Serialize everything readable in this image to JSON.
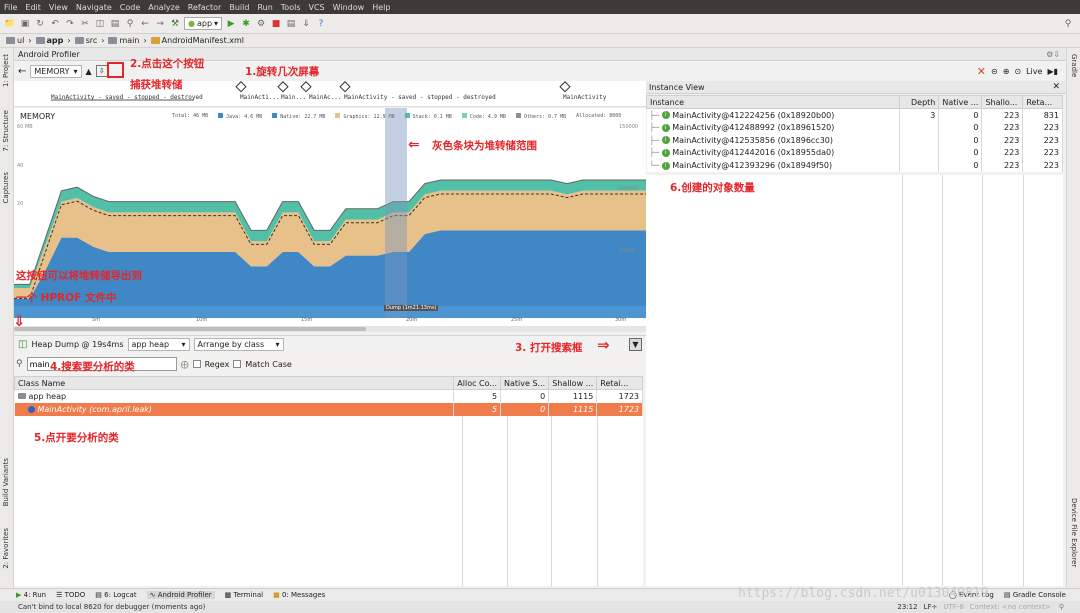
{
  "menu": [
    "File",
    "Edit",
    "View",
    "Navigate",
    "Code",
    "Analyze",
    "Refactor",
    "Build",
    "Run",
    "Tools",
    "VCS",
    "Window",
    "Help"
  ],
  "toolbar": {
    "run_config": "app",
    "help_label": "?"
  },
  "breadcrumb": [
    "ul",
    "app",
    "src",
    "main",
    "AndroidManifest.xml"
  ],
  "profiler": {
    "title": "Android Profiler",
    "monitor": "MEMORY",
    "live_label": "Live",
    "chart_title": "MEMORY",
    "legend": [
      "Total: 46 MB",
      "Java: 4.6 MB",
      "Native: 22.7 MB",
      "Graphics: 12.9 MB",
      "Stack: 0.1 MB",
      "Code: 4.9 MB",
      "Others: 0.7 MB",
      "Allocated: 8000"
    ],
    "y_labels": [
      "60 MB",
      "40",
      "20",
      "150000",
      "100000",
      "50000"
    ],
    "x_labels": [
      "5m",
      "10m",
      "15m",
      "20m",
      "25m",
      "30m"
    ],
    "activity_labels": [
      "MainActivity - saved - stopped - destroyed",
      "MainActi...",
      "Main...",
      "MainAc...",
      "MainActivity - saved - stopped - destroyed",
      "MainActivity"
    ],
    "dump_tooltip": "Dump (1m21.13ms)"
  },
  "heap": {
    "dump_label": "Heap Dump @ 19s4ms",
    "heap_select": "app heap",
    "arrange_select": "Arrange by class",
    "search_value": "main",
    "regex_label": "Regex",
    "match_case_label": "Match Case",
    "columns": [
      "Class Name",
      "Alloc Co...",
      "Native S...",
      "Shallow ...",
      "Retai..."
    ],
    "rows": [
      {
        "name": "app heap",
        "alloc": "5",
        "native": "0",
        "shallow": "1115",
        "retained": "1723"
      },
      {
        "name": "MainActivity (com.april.leak)",
        "alloc": "5",
        "native": "0",
        "shallow": "1115",
        "retained": "1723"
      }
    ]
  },
  "instance_view": {
    "title": "Instance View",
    "columns": [
      "Instance",
      "Depth",
      "Native ...",
      "Shallo...",
      "Reta..."
    ],
    "rows": [
      {
        "name": "MainActivity@412224256 (0x18920b00)",
        "depth": "3",
        "native": "0",
        "shallow": "223",
        "retained": "831"
      },
      {
        "name": "MainActivity@412488992 (0x18961520)",
        "depth": "",
        "native": "0",
        "shallow": "223",
        "retained": "223"
      },
      {
        "name": "MainActivity@412535856 (0x1896cc30)",
        "depth": "",
        "native": "0",
        "shallow": "223",
        "retained": "223"
      },
      {
        "name": "MainActivity@412442016 (0x18955da0)",
        "depth": "",
        "native": "0",
        "shallow": "223",
        "retained": "223"
      },
      {
        "name": "MainActivity@412393296 (0x18949f50)",
        "depth": "",
        "native": "0",
        "shallow": "223",
        "retained": "223"
      }
    ]
  },
  "side_tabs": {
    "left": [
      "1: Project",
      "7: Structure",
      "Captures",
      "Build Variants",
      "2: Favorites"
    ],
    "right": [
      "Gradle",
      "Device File Explorer"
    ]
  },
  "bottom_tabs": [
    "4: Run",
    "TODO",
    "6: Logcat",
    "Android Profiler",
    "Terminal",
    "0: Messages"
  ],
  "bottom_right": [
    "Event Log",
    "Gradle Console"
  ],
  "status": {
    "message": "Can't bind to local 8620 for debugger (moments ago)",
    "position": "23:12",
    "lf": "LF÷",
    "encoding": "UTF-8",
    "context": "Context: <no context>"
  },
  "annotations": {
    "a1": "1.旋转几次屏幕",
    "a2": "2.点击这个按钮",
    "a2b": "捕获堆转储",
    "a3": "3. 打开搜索框",
    "a4": "4.搜索要分析的类",
    "a5": "5.点开要分析的类",
    "a6": "6.创建的对象数量",
    "a7": "灰色条块为堆转储范围",
    "a8": "这按钮可以将堆转储导出到",
    "a8b": "一个 HPROF 文件中"
  },
  "watermark": "https://blog.csdn.net/u013040819",
  "chart_data": {
    "type": "area",
    "title": "MEMORY",
    "x": [
      0,
      1,
      2,
      3,
      4,
      5,
      6,
      7,
      8,
      9,
      10,
      11,
      12,
      13,
      14,
      15,
      16,
      17,
      18,
      19,
      20,
      21,
      22,
      23,
      24,
      25,
      26,
      27,
      28,
      29,
      30,
      31,
      32,
      33,
      34,
      35,
      36,
      37,
      38,
      39,
      40
    ],
    "series": [
      {
        "name": "Java",
        "values": [
          4,
          4,
          20,
          38,
          38,
          33,
          30,
          30,
          30,
          30,
          30,
          30,
          30,
          30,
          30,
          22,
          22,
          30,
          30,
          22,
          22,
          28,
          28,
          28,
          30,
          30,
          40,
          42,
          42,
          42,
          42,
          42,
          42,
          42,
          42,
          42,
          42,
          42,
          42,
          42,
          42
        ]
      },
      {
        "name": "Native",
        "values": [
          6,
          6,
          14,
          20,
          22,
          22,
          22,
          22,
          22,
          22,
          22,
          22,
          22,
          22,
          22,
          14,
          14,
          22,
          22,
          14,
          14,
          20,
          20,
          20,
          22,
          22,
          22,
          22,
          22,
          22,
          22,
          22,
          22,
          22,
          22,
          20,
          22,
          22,
          22,
          22,
          22
        ]
      },
      {
        "name": "Graphics",
        "values": [
          2,
          2,
          4,
          6,
          6,
          6,
          6,
          6,
          6,
          6,
          6,
          6,
          6,
          6,
          6,
          6,
          6,
          6,
          6,
          6,
          6,
          6,
          6,
          6,
          6,
          6,
          6,
          6,
          6,
          6,
          6,
          6,
          6,
          6,
          6,
          6,
          6,
          6,
          6,
          6,
          6
        ]
      }
    ],
    "ylim": [
      0,
      100
    ]
  }
}
